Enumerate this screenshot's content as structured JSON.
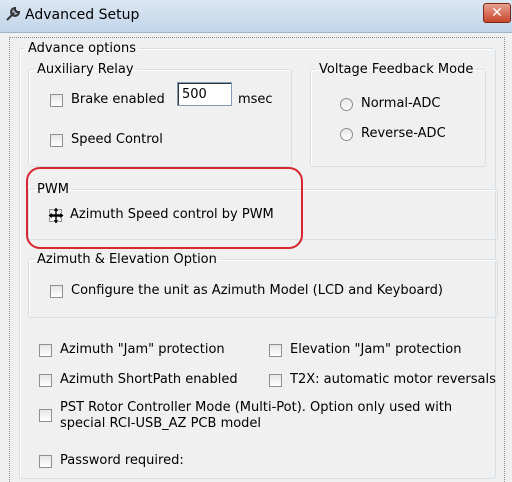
{
  "window": {
    "title": "Advanced Setup",
    "close_glyph": "✕"
  },
  "advance_options": {
    "legend": "Advance options"
  },
  "auxiliary_relay": {
    "legend": "Auxiliary Relay",
    "brake_enabled_label": "Brake enabled",
    "brake_value": "500",
    "brake_unit": "msec",
    "speed_control_label": "Speed Control"
  },
  "voltage_feedback": {
    "legend": "Voltage Feedback Mode",
    "normal_label": "Normal-ADC",
    "reverse_label": "Reverse-ADC"
  },
  "pwm": {
    "legend": "PWM",
    "azimuth_pwm_label": "Azimuth Speed control by PWM"
  },
  "az_el": {
    "legend": "Azimuth & Elevation Option",
    "configure_label": "Configure the unit as Azimuth Model (LCD and Keyboard)"
  },
  "options": {
    "az_jam_label": "Azimuth \"Jam\" protection",
    "el_jam_label": "Elevation \"Jam\" protection",
    "az_shortpath_label": "Azimuth ShortPath enabled",
    "t2x_label": "T2X: automatic motor reversals",
    "pst_line1": "PST Rotor Controller Mode (Multi-Pot). Option only used with",
    "pst_line2": "special RCI-USB_AZ PCB model",
    "password_label": "Password required:"
  },
  "colors": {
    "highlight": "#d6262e",
    "close_button": "#c7462c"
  },
  "icons": {
    "app": "wrench-icon",
    "close": "close-icon"
  }
}
